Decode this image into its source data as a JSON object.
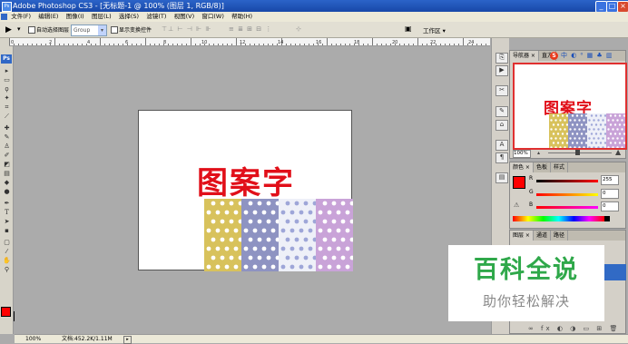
{
  "window": {
    "title": "Adobe Photoshop CS3 - [无标题-1 @ 100% (图层 1, RGB/8)]",
    "controls": [
      "_",
      "□",
      "×"
    ]
  },
  "menu": [
    "文件(F)",
    "编辑(E)",
    "图像(I)",
    "图层(L)",
    "选择(S)",
    "滤镜(T)",
    "视图(V)",
    "窗口(W)",
    "帮助(H)"
  ],
  "options": {
    "auto_select_label": "自动选择图层",
    "auto_select_value": "Group",
    "show_transform_label": "显示变换控件",
    "workspace_label": "工作区 ▾"
  },
  "ruler_labels": [
    "0",
    "2",
    "4",
    "6",
    "8",
    "10",
    "12",
    "14",
    "16",
    "18",
    "20",
    "22",
    "24"
  ],
  "canvas": {
    "text": "图案字",
    "text_color": "#e10f19"
  },
  "navigator": {
    "tabs": [
      "导航器 ×",
      "直方"
    ],
    "zoom": "100%",
    "thumb_text": "图案字"
  },
  "color_panel": {
    "tabs": [
      "颜色 ×",
      "色板",
      "样式"
    ],
    "channels": [
      {
        "label": "R",
        "value": "255"
      },
      {
        "label": "G",
        "value": "0"
      },
      {
        "label": "B",
        "value": "0"
      }
    ],
    "fg_color": "#ff0000"
  },
  "layers_panel": {
    "tabs": [
      "图层 ×",
      "通道",
      "路径"
    ]
  },
  "status": {
    "zoom": "100%",
    "doc_info": "文档:452.2K/1.11M"
  },
  "watermark": {
    "brand": "百科全说",
    "slogan": "助你轻松解决",
    "brand_color": "#2fa84a"
  },
  "patterns": [
    {
      "bg": "#d8c25c",
      "dot": "#ffffff"
    },
    {
      "bg": "#8e93c2",
      "dot": "#ffffff"
    },
    {
      "bg": "#eef0f8",
      "dot": "#9ea6d8"
    },
    {
      "bg": "#c9a3d8",
      "dot": "#ffffff"
    }
  ]
}
